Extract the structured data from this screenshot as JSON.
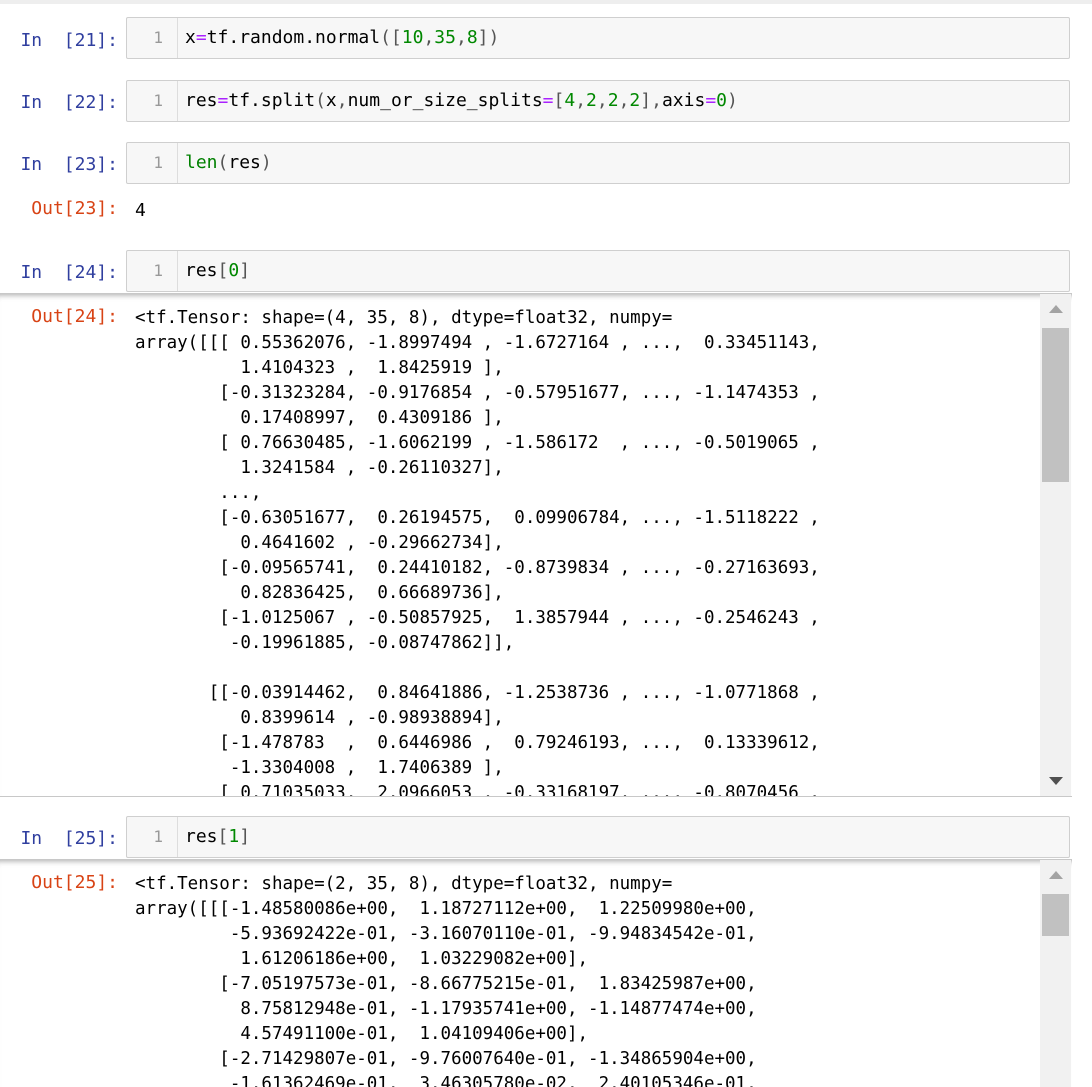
{
  "cells": [
    {
      "in_prompt": "In  [21]:",
      "line_no": "1",
      "code": "x=tf.random.normal([10,35,8])"
    },
    {
      "in_prompt": "In  [22]:",
      "line_no": "1",
      "code": "res=tf.split(x,num_or_size_splits=[4,2,2,2],axis=0)"
    },
    {
      "in_prompt": "In  [23]:",
      "line_no": "1",
      "code": "len(res)",
      "out_prompt": "Out[23]:",
      "output": "4"
    },
    {
      "in_prompt": "In  [24]:",
      "line_no": "1",
      "code": "res[0]",
      "out_prompt": "Out[24]:",
      "output": "<tf.Tensor: shape=(4, 35, 8), dtype=float32, numpy=\narray([[[ 0.55362076, -1.8997494 , -1.6727164 , ...,  0.33451143,\n          1.4104323 ,  1.8425919 ],\n        [-0.31323284, -0.9176854 , -0.57951677, ..., -1.1474353 ,\n          0.17408997,  0.4309186 ],\n        [ 0.76630485, -1.6062199 , -1.586172  , ..., -0.5019065 ,\n          1.3241584 , -0.26110327],\n        ...,\n        [-0.63051677,  0.26194575,  0.09906784, ..., -1.5118222 ,\n          0.4641602 , -0.29662734],\n        [-0.09565741,  0.24410182, -0.8739834 , ..., -0.27163693,\n          0.82836425,  0.66689736],\n        [-1.0125067 , -0.50857925,  1.3857944 , ..., -0.2546243 ,\n         -0.19961885, -0.08747862]],\n\n       [[-0.03914462,  0.84641886, -1.2538736 , ..., -1.0771868 ,\n          0.8399614 , -0.98938894],\n        [-1.478783  ,  0.6446986 ,  0.79246193, ...,  0.13339612,\n         -1.3304008 ,  1.7406389 ],\n        [ 0.71035033,  2.0966053 , -0.33168197, ..., -0.8070456 ,"
    },
    {
      "in_prompt": "In  [25]:",
      "line_no": "1",
      "code": "res[1]",
      "out_prompt": "Out[25]:",
      "output": "<tf.Tensor: shape=(2, 35, 8), dtype=float32, numpy=\narray([[[-1.48580086e+00,  1.18727112e+00,  1.22509980e+00,\n         -5.93692422e-01, -3.16070110e-01, -9.94834542e-01,\n          1.61206186e+00,  1.03229082e+00],\n        [-7.05197573e-01, -8.66775215e-01,  1.83425987e+00,\n          8.75812948e-01, -1.17935741e+00, -1.14877474e+00,\n          4.57491100e-01,  1.04109406e+00],\n        [-2.71429807e-01, -9.76007640e-01, -1.34865904e+00,\n         -1.61362469e-01,  3.46305780e-02,  2.40105346e-01,"
    }
  ],
  "colors": {
    "in_prompt": "#303f9f",
    "out_prompt": "#d84315",
    "input_bg": "#f7f7f7",
    "scroll_thumb": "#c1c1c1"
  },
  "scroll_icons": [
    "scroll-up-arrow-icon",
    "scroll-down-arrow-icon"
  ]
}
